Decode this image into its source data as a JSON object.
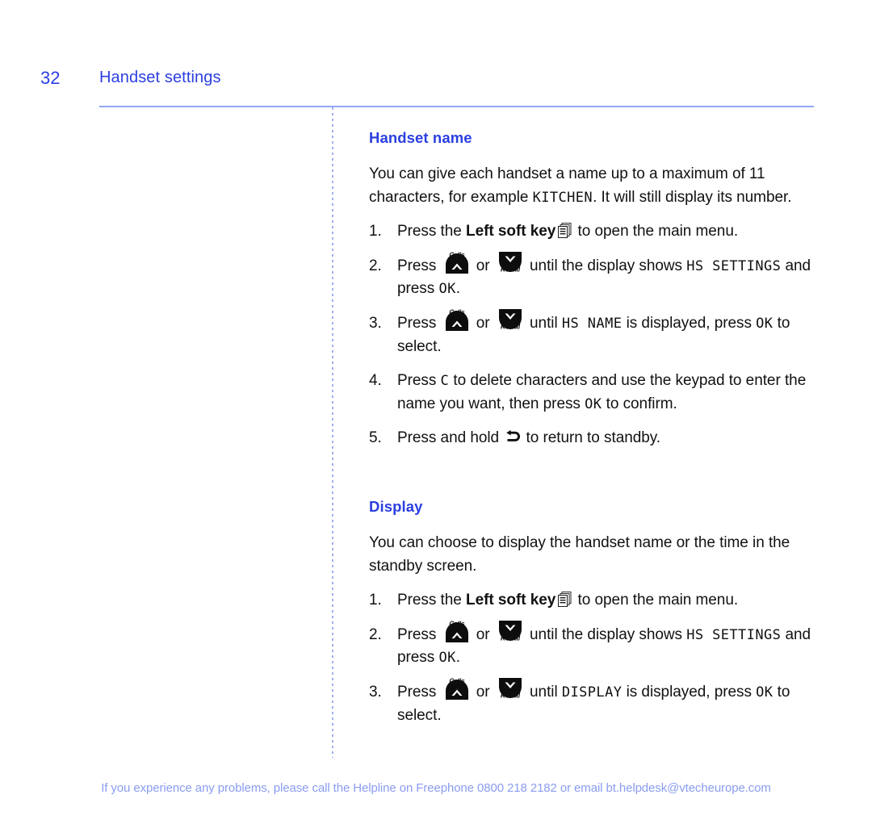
{
  "header": {
    "page_number": "32",
    "title": "Handset settings",
    "rule_color": "#93a7f5"
  },
  "colors": {
    "heading_blue": "#2b3fe0",
    "body_black": "#111111",
    "footer_blue": "#8a9cf0",
    "divider_blue": "#9fb2f2"
  },
  "sections": [
    {
      "heading": "Handset name",
      "intro": [
        {
          "t": "text",
          "v": "You can give each handset a name up to a maximum of 11 characters, for example "
        },
        {
          "t": "lcd",
          "v": "KITCHEN"
        },
        {
          "t": "text",
          "v": ". It will still display its number."
        }
      ],
      "steps": [
        {
          "num": "1.",
          "parts": [
            {
              "t": "text",
              "v": "Press the "
            },
            {
              "t": "bold",
              "v": "Left soft key"
            },
            {
              "t": "icon",
              "v": "soft-key-icon"
            },
            {
              "t": "text",
              "v": " to open the main menu."
            }
          ]
        },
        {
          "num": "2.",
          "parts": [
            {
              "t": "text",
              "v": "Press "
            },
            {
              "t": "icon",
              "v": "up-calls-key-icon"
            },
            {
              "t": "text",
              "v": " or "
            },
            {
              "t": "icon",
              "v": "down-redial-key-icon"
            },
            {
              "t": "text",
              "v": " until the display shows "
            },
            {
              "t": "lcd",
              "v": "HS SETTINGS"
            },
            {
              "t": "text",
              "v": " and press "
            },
            {
              "t": "lcd",
              "v": "OK"
            },
            {
              "t": "text",
              "v": "."
            }
          ]
        },
        {
          "num": "3.",
          "parts": [
            {
              "t": "text",
              "v": "Press "
            },
            {
              "t": "icon",
              "v": "up-calls-key-icon"
            },
            {
              "t": "text",
              "v": " or "
            },
            {
              "t": "icon",
              "v": "down-redial-key-icon"
            },
            {
              "t": "text",
              "v": " until "
            },
            {
              "t": "lcd",
              "v": "HS NAME"
            },
            {
              "t": "text",
              "v": " is displayed, press "
            },
            {
              "t": "lcd",
              "v": "OK"
            },
            {
              "t": "text",
              "v": " to select."
            }
          ]
        },
        {
          "num": "4.",
          "parts": [
            {
              "t": "text",
              "v": "Press "
            },
            {
              "t": "lcd",
              "v": "C"
            },
            {
              "t": "text",
              "v": " to delete characters and use the keypad to enter the name you want, then press "
            },
            {
              "t": "lcd",
              "v": "OK"
            },
            {
              "t": "text",
              "v": " to confirm."
            }
          ]
        },
        {
          "num": "5.",
          "parts": [
            {
              "t": "text",
              "v": "Press and hold "
            },
            {
              "t": "icon",
              "v": "return-arrow-icon"
            },
            {
              "t": "text",
              "v": " to return to standby."
            }
          ]
        }
      ]
    },
    {
      "heading": "Display",
      "intro": [
        {
          "t": "text",
          "v": "You can choose to display the handset name or the time in the standby screen."
        }
      ],
      "steps": [
        {
          "num": "1.",
          "parts": [
            {
              "t": "text",
              "v": "Press the "
            },
            {
              "t": "bold",
              "v": "Left soft key"
            },
            {
              "t": "icon",
              "v": "soft-key-icon"
            },
            {
              "t": "text",
              "v": " to open the main menu."
            }
          ]
        },
        {
          "num": "2.",
          "parts": [
            {
              "t": "text",
              "v": "Press "
            },
            {
              "t": "icon",
              "v": "up-calls-key-icon"
            },
            {
              "t": "text",
              "v": " or "
            },
            {
              "t": "icon",
              "v": "down-redial-key-icon"
            },
            {
              "t": "text",
              "v": " until the display shows "
            },
            {
              "t": "lcd",
              "v": "HS SETTINGS"
            },
            {
              "t": "text",
              "v": " and press "
            },
            {
              "t": "lcd",
              "v": "OK"
            },
            {
              "t": "text",
              "v": "."
            }
          ]
        },
        {
          "num": "3.",
          "parts": [
            {
              "t": "text",
              "v": "Press "
            },
            {
              "t": "icon",
              "v": "up-calls-key-icon"
            },
            {
              "t": "text",
              "v": " or "
            },
            {
              "t": "icon",
              "v": "down-redial-key-icon"
            },
            {
              "t": "text",
              "v": " until "
            },
            {
              "t": "lcd",
              "v": "DISPLAY"
            },
            {
              "t": "text",
              "v": " is displayed, press "
            },
            {
              "t": "lcd",
              "v": "OK"
            },
            {
              "t": "text",
              "v": " to select."
            }
          ]
        }
      ]
    }
  ],
  "icon_labels": {
    "up_key": "Calls",
    "down_key": "Redial"
  },
  "footer": {
    "text": "If you experience any problems, please call the Helpline on Freephone 0800 218 2182 or email bt.helpdesk@vtecheurope.com"
  }
}
